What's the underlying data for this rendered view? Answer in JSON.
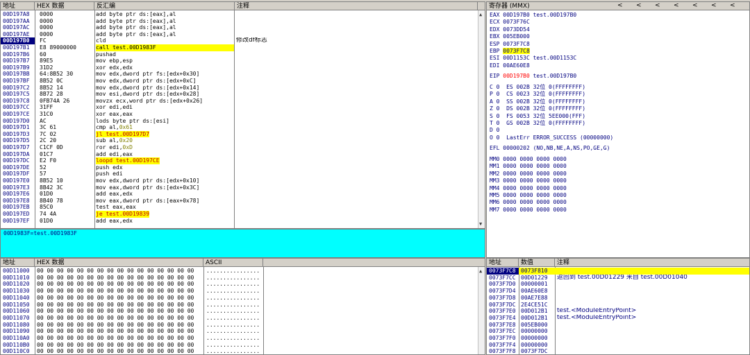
{
  "disasm": {
    "headers": {
      "addr": "地址",
      "hex": "HEX 数据",
      "disasm": "反汇编",
      "comment": "注释"
    },
    "rows": [
      {
        "addr": "00D197A8",
        "hex": "0000",
        "asm": "add byte ptr ds:[eax],al",
        "comment": ""
      },
      {
        "addr": "00D197AA",
        "hex": "0000",
        "asm": "add byte ptr ds:[eax],al",
        "comment": ""
      },
      {
        "addr": "00D197AC",
        "hex": "0000",
        "asm": "add byte ptr ds:[eax],al",
        "comment": ""
      },
      {
        "addr": "00D197AE",
        "hex": "0000",
        "asm": "add byte ptr ds:[eax],al",
        "comment": ""
      },
      {
        "addr": "00D197B0",
        "hex": "FC",
        "asm": "cld",
        "comment": "修改df标志"
      },
      {
        "addr": "00D197B1",
        "hex": "E8 89000000",
        "asm": "call test.00D1983F",
        "comment": ""
      },
      {
        "addr": "00D197B6",
        "hex": "60",
        "asm": "pushad",
        "comment": ""
      },
      {
        "addr": "00D197B7",
        "hex": "89E5",
        "asm": "mov ebp,esp",
        "comment": ""
      },
      {
        "addr": "00D197B9",
        "hex": "31D2",
        "asm": "xor edx,edx",
        "comment": ""
      },
      {
        "addr": "00D197BB",
        "hex": "64:8B52 30",
        "asm": "mov edx,dword ptr fs:[edx+0x30]",
        "comment": ""
      },
      {
        "addr": "00D197BF",
        "hex": "8B52 0C",
        "asm": "mov edx,dword ptr ds:[edx+0xC]",
        "comment": ""
      },
      {
        "addr": "00D197C2",
        "hex": "8B52 14",
        "asm": "mov edx,dword ptr ds:[edx+0x14]",
        "comment": ""
      },
      {
        "addr": "00D197C5",
        "hex": "8B72 28",
        "asm": "mov esi,dword ptr ds:[edx+0x28]",
        "comment": ""
      },
      {
        "addr": "00D197C8",
        "hex": "0FB74A 26",
        "asm": "movzx ecx,word ptr ds:[edx+0x26]",
        "comment": ""
      },
      {
        "addr": "00D197CC",
        "hex": "31FF",
        "asm": "xor edi,edi",
        "comment": ""
      },
      {
        "addr": "00D197CE",
        "hex": "31C0",
        "asm": "xor eax,eax",
        "comment": ""
      },
      {
        "addr": "00D197D0",
        "hex": "AC",
        "asm": "lods byte ptr ds:[esi]",
        "comment": ""
      },
      {
        "addr": "00D197D1",
        "hex": "3C 61",
        "asm": "cmp al,",
        "imm": "0x61",
        "comment": ""
      },
      {
        "addr": "00D197D3",
        "hex": "7C 02",
        "asm": "jl ",
        "target": "test.00D197D7",
        "comment": ""
      },
      {
        "addr": "00D197D5",
        "hex": "2C 20",
        "asm": "sub al,",
        "imm": "0x20",
        "comment": ""
      },
      {
        "addr": "00D197D7",
        "hex": "C1CF 0D",
        "asm": "ror edi,",
        "imm": "0xD",
        "comment": ""
      },
      {
        "addr": "00D197DA",
        "hex": "01C7",
        "asm": "add edi,eax",
        "comment": ""
      },
      {
        "addr": "00D197DC",
        "hex": "E2 F0",
        "asm": "loopd ",
        "target": "test.00D197CE",
        "comment": ""
      },
      {
        "addr": "00D197DE",
        "hex": "52",
        "asm": "push edx",
        "comment": ""
      },
      {
        "addr": "00D197DF",
        "hex": "57",
        "asm": "push edi",
        "comment": ""
      },
      {
        "addr": "00D197E0",
        "hex": "8B52 10",
        "asm": "mov edx,dword ptr ds:[edx+0x10]",
        "comment": ""
      },
      {
        "addr": "00D197E3",
        "hex": "8B42 3C",
        "asm": "mov eax,dword ptr ds:[edx+0x3C]",
        "comment": ""
      },
      {
        "addr": "00D197E6",
        "hex": "01D0",
        "asm": "add eax,edx",
        "comment": ""
      },
      {
        "addr": "00D197E8",
        "hex": "8B40 78",
        "asm": "mov eax,dword ptr ds:[eax+0x78]",
        "comment": ""
      },
      {
        "addr": "00D197EB",
        "hex": "85C0",
        "asm": "test eax,eax",
        "comment": ""
      },
      {
        "addr": "00D197ED",
        "hex": "74 4A",
        "asm": "je ",
        "target": "test.00D19839",
        "comment": ""
      },
      {
        "addr": "00D197EF",
        "hex": "01D0",
        "asm": "add eax,edx",
        "comment": ""
      }
    ],
    "info_line": "00D1983F=test.00D1983F"
  },
  "registers": {
    "title": "寄存器 (MMX)",
    "nav": [
      "<",
      "<",
      "<",
      "<",
      "<",
      "<",
      "<"
    ],
    "gp": [
      {
        "name": "EAX",
        "val": "00D197B0",
        "note": "test.00D197B0"
      },
      {
        "name": "ECX",
        "val": "0073F76C",
        "note": ""
      },
      {
        "name": "EDX",
        "val": "0073DD54",
        "note": ""
      },
      {
        "name": "EBX",
        "val": "005EB000",
        "note": ""
      },
      {
        "name": "ESP",
        "val": "0073F7C8",
        "note": ""
      },
      {
        "name": "EBP",
        "val": "0073F7C8",
        "note": ""
      },
      {
        "name": "ESI",
        "val": "00D1153C",
        "note": "test.00D1153C"
      },
      {
        "name": "EDI",
        "val": "00AE60E8",
        "note": ""
      }
    ],
    "eip": {
      "name": "EIP",
      "val": "00D197B0",
      "note": "test.00D197B0"
    },
    "segs": [
      "C 0  ES 002B 32位 0(FFFFFFFF)",
      "P 0  CS 0023 32位 0(FFFFFFFF)",
      "A 0  SS 002B 32位 0(FFFFFFFF)",
      "Z 0  DS 002B 32位 0(FFFFFFFF)",
      "S 0  FS 0053 32位 5EE000(FFF)",
      "T 0  GS 002B 32位 0(FFFFFFFF)",
      "D 0",
      "O 0  LastErr ERROR_SUCCESS (00000000)"
    ],
    "efl": "EFL 00000202 (NO,NB,NE,A,NS,PO,GE,G)",
    "mmx": [
      "MM0 0000 0000 0000 0000",
      "MM1 0000 0000 0000 0000",
      "MM2 0000 0000 0000 0000",
      "MM3 0000 0000 0000 0000",
      "MM4 0000 0000 0000 0000",
      "MM5 0000 0000 0000 0000",
      "MM6 0000 0000 0000 0000",
      "MM7 0000 0000 0000 0000"
    ]
  },
  "dump": {
    "headers": {
      "addr": "地址",
      "hex": "HEX 数据",
      "ascii": "ASCII"
    },
    "hex_line": "00 00 00 00 00 00 00 00 00 00 00 00 00 00 00 00",
    "ascii_line": "................",
    "addrs": [
      "00D11000",
      "00D11010",
      "00D11020",
      "00D11030",
      "00D11040",
      "00D11050",
      "00D11060",
      "00D11070",
      "00D11080",
      "00D11090",
      "00D110A0",
      "00D110B0",
      "00D110C0"
    ]
  },
  "stack": {
    "headers": {
      "addr": "地址",
      "val": "数值",
      "comment": "注释"
    },
    "rows": [
      {
        "addr": "0073F7C8",
        "val": "0073F810",
        "comment": ""
      },
      {
        "addr": "0073F7CC",
        "val": "00D01229",
        "comment": "返回到 test.00D01229 来自 test.00D01040"
      },
      {
        "addr": "0073F7D0",
        "val": "00000001",
        "comment": ""
      },
      {
        "addr": "0073F7D4",
        "val": "00AE60E8",
        "comment": ""
      },
      {
        "addr": "0073F7D8",
        "val": "00AE7E88",
        "comment": ""
      },
      {
        "addr": "0073F7DC",
        "val": "2E4CE51C",
        "comment": ""
      },
      {
        "addr": "0073F7E0",
        "val": "00D012B1",
        "comment": "test.<ModuleEntryPoint>"
      },
      {
        "addr": "0073F7E4",
        "val": "00D012B1",
        "comment": "test.<ModuleEntryPoint>"
      },
      {
        "addr": "0073F7E8",
        "val": "005EB000",
        "comment": ""
      },
      {
        "addr": "0073F7EC",
        "val": "00000000",
        "comment": ""
      },
      {
        "addr": "0073F7F0",
        "val": "00000000",
        "comment": ""
      },
      {
        "addr": "0073F7F4",
        "val": "00000000",
        "comment": ""
      },
      {
        "addr": "0073F7F8",
        "val": "0073F7DC",
        "comment": ""
      }
    ]
  },
  "colors": {
    "highlight": "#ffff00",
    "info_bar": "#00ffff",
    "address": "#000080",
    "changed": "#ff0000"
  }
}
